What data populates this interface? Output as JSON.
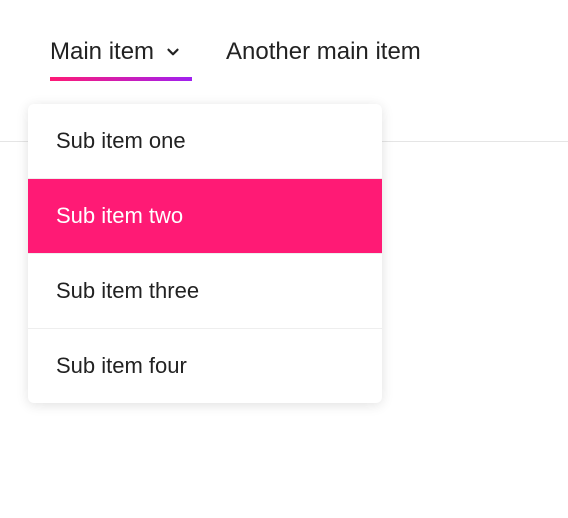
{
  "nav": {
    "items": [
      {
        "label": "Main item",
        "active": true,
        "hasDropdown": true
      },
      {
        "label": "Another main item",
        "active": false,
        "hasDropdown": false
      }
    ]
  },
  "dropdown": {
    "items": [
      {
        "label": "Sub item one",
        "selected": false
      },
      {
        "label": "Sub item two",
        "selected": true
      },
      {
        "label": "Sub item three",
        "selected": false
      },
      {
        "label": "Sub item four",
        "selected": false
      }
    ]
  },
  "colors": {
    "accentStart": "#ff1a75",
    "accentEnd": "#a020f0",
    "highlight": "#ff1a75"
  }
}
